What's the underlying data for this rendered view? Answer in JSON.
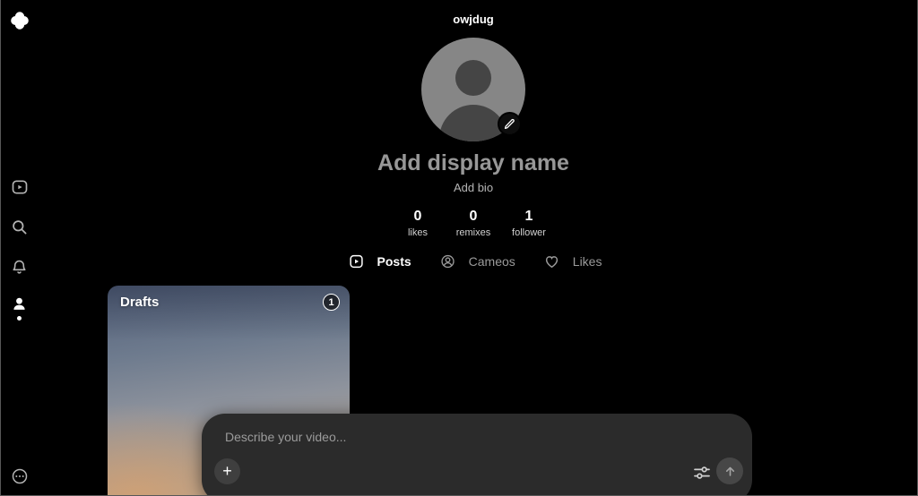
{
  "header": {
    "username": "owjdug"
  },
  "sidebar": {
    "items": [
      {
        "id": "explore",
        "icon": "play-video-icon"
      },
      {
        "id": "search",
        "icon": "search-icon"
      },
      {
        "id": "notifications",
        "icon": "bell-icon"
      },
      {
        "id": "profile",
        "icon": "person-icon",
        "active": true
      },
      {
        "id": "more",
        "icon": "more-circle-icon"
      }
    ]
  },
  "profile": {
    "display_name_placeholder": "Add display name",
    "bio_placeholder": "Add bio",
    "stats": [
      {
        "value": "0",
        "label": "likes"
      },
      {
        "value": "0",
        "label": "remixes"
      },
      {
        "value": "1",
        "label": "follower"
      }
    ],
    "tabs": [
      {
        "label": "Posts",
        "icon": "posts-play-icon",
        "active": true
      },
      {
        "label": "Cameos",
        "icon": "cameo-person-icon",
        "active": false
      },
      {
        "label": "Likes",
        "icon": "heart-icon",
        "active": false
      }
    ]
  },
  "content": {
    "drafts_card": {
      "title": "Drafts",
      "count": "1"
    }
  },
  "composer": {
    "placeholder": "Describe your video...",
    "add_label": "+"
  },
  "colors": {
    "background": "#000000",
    "panel": "#2b2b2b",
    "muted_text": "#9b9b9b",
    "avatar_gray": "#868686"
  }
}
